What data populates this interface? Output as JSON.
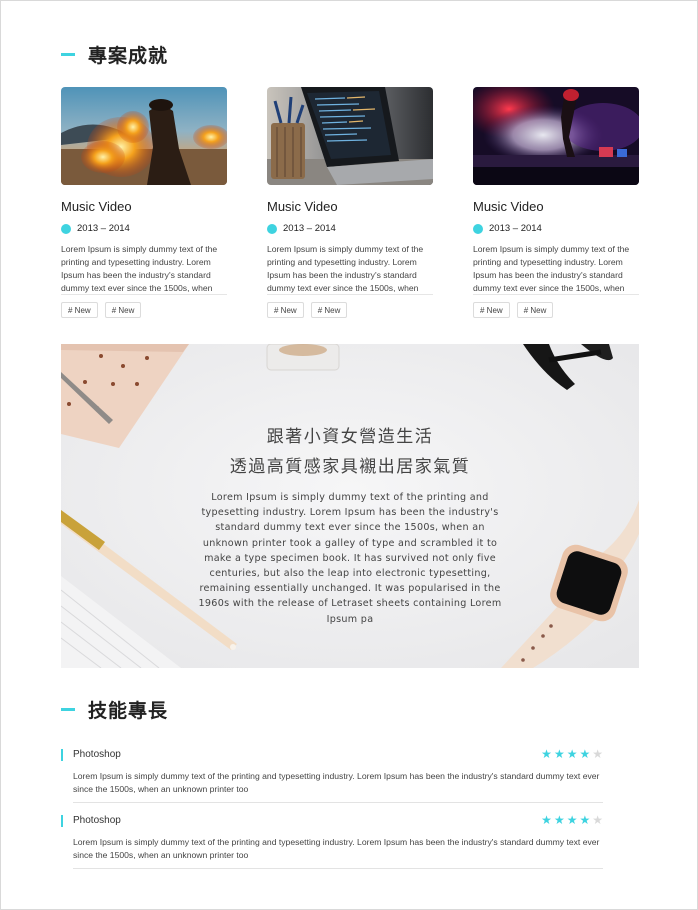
{
  "projects": {
    "title": "專案成就",
    "cards": [
      {
        "title": "Music Video",
        "date": "2013 – 2014",
        "description": "Lorem Ipsum is simply dummy text of the printing and typesetting industry. Lorem Ipsum has been the industry's standard dummy text ever since the 1500s, when",
        "tags": [
          "# New",
          "# New"
        ],
        "image": "smoke-flare-photo"
      },
      {
        "title": "Music Video",
        "date": "2013 – 2014",
        "description": "Lorem Ipsum is simply dummy text of the printing and typesetting industry. Lorem Ipsum has been the industry's standard dummy text ever since the 1500s, when",
        "tags": [
          "# New",
          "# New"
        ],
        "image": "laptop-code-photo"
      },
      {
        "title": "Music Video",
        "date": "2013 – 2014",
        "description": "Lorem Ipsum is simply dummy text of the printing and typesetting industry. Lorem Ipsum has been the industry's standard dummy text ever since the 1500s, when",
        "tags": [
          "# New",
          "# New"
        ],
        "image": "stage-dancer-photo"
      }
    ]
  },
  "banner": {
    "heading_line1": "跟著小資女營造生活",
    "heading_line2": "透過高質感家具襯出居家氣質",
    "body": "Lorem Ipsum is simply dummy text of the printing and typesetting industry. Lorem Ipsum has been the industry's standard dummy text ever since the 1500s, when an unknown printer took a galley of type and scrambled it to make a type specimen book. It has survived not only five centuries, but also the leap into electronic typesetting, remaining essentially unchanged. It was popularised in the 1960s with the release of Letraset sheets containing Lorem Ipsum pa"
  },
  "skills": {
    "title": "技能專長",
    "items": [
      {
        "name": "Photoshop",
        "rating": 4,
        "max": 5,
        "description": "Lorem Ipsum is simply dummy text of the printing and typesetting industry. Lorem Ipsum has been the industry's standard dummy text ever since the 1500s, when an unknown printer too"
      },
      {
        "name": "Photoshop",
        "rating": 4,
        "max": 5,
        "description": "Lorem Ipsum is simply dummy text of the printing and typesetting industry. Lorem Ipsum has been the industry's standard dummy text ever since the 1500s, when an unknown printer too"
      }
    ]
  },
  "colors": {
    "accent": "#3ed3e0",
    "text": "#333333",
    "star_off": "#d9d9d9"
  }
}
